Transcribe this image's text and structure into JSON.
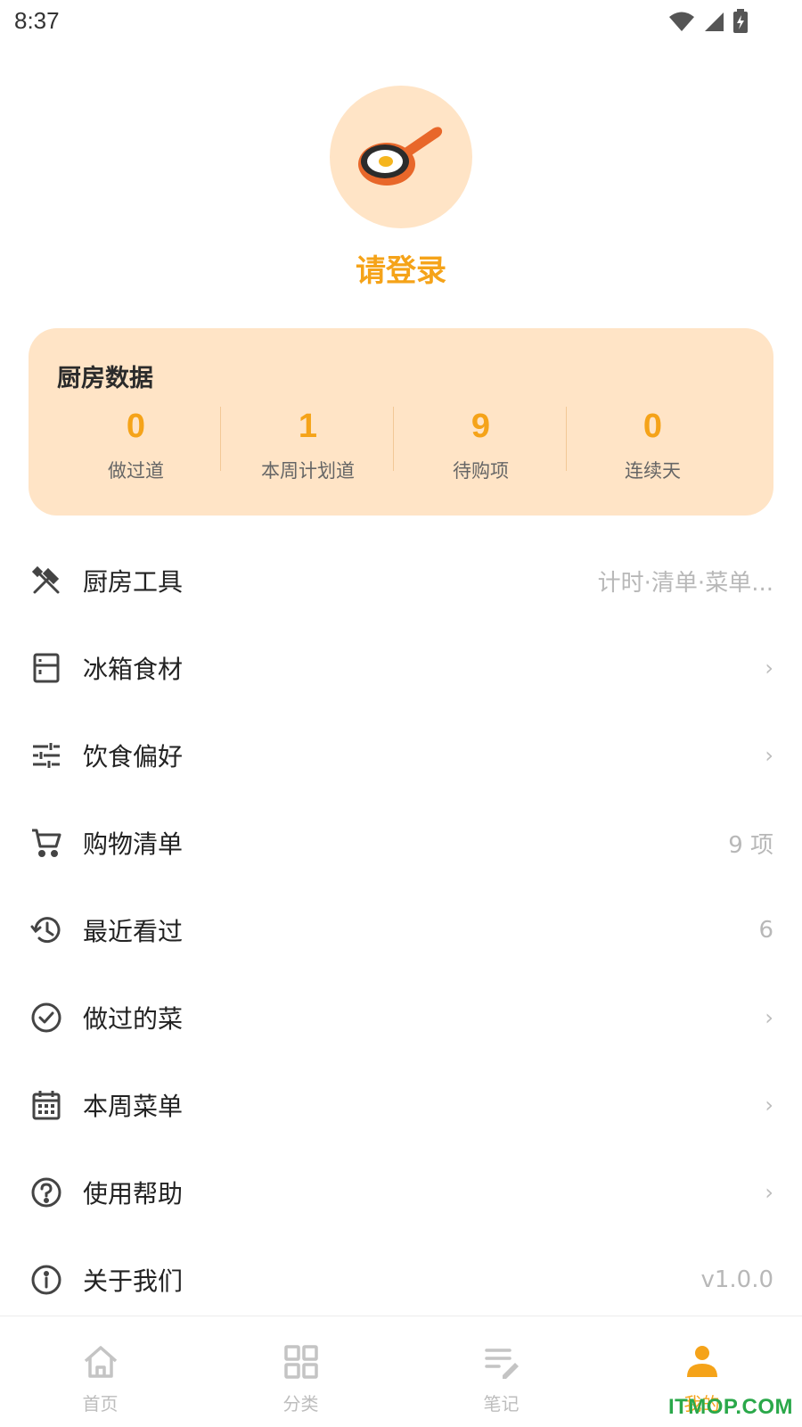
{
  "status": {
    "time": "8:37"
  },
  "profile": {
    "login_text": "请登录",
    "avatar_icon": "frying-pan-egg-icon"
  },
  "stats": {
    "title": "厨房数据",
    "items": [
      {
        "value": "0",
        "label": "做过道"
      },
      {
        "value": "1",
        "label": "本周计划道"
      },
      {
        "value": "9",
        "label": "待购项"
      },
      {
        "value": "0",
        "label": "连续天"
      }
    ]
  },
  "menu": [
    {
      "label": "厨房工具",
      "extra": "计时·清单·菜单...",
      "icon": "tools-icon"
    },
    {
      "label": "冰箱食材",
      "extra": "›",
      "icon": "fridge-icon"
    },
    {
      "label": "饮食偏好",
      "extra": "›",
      "icon": "sliders-icon"
    },
    {
      "label": "购物清单",
      "extra": "9 项",
      "icon": "cart-icon"
    },
    {
      "label": "最近看过",
      "extra": "6",
      "icon": "history-icon"
    },
    {
      "label": "做过的菜",
      "extra": "›",
      "icon": "check-circle-icon"
    },
    {
      "label": "本周菜单",
      "extra": "›",
      "icon": "calendar-icon"
    },
    {
      "label": "使用帮助",
      "extra": "›",
      "icon": "help-icon"
    },
    {
      "label": "关于我们",
      "extra": "v1.0.0",
      "icon": "info-icon"
    }
  ],
  "tabs": [
    {
      "label": "首页",
      "icon": "home-icon"
    },
    {
      "label": "分类",
      "icon": "grid-icon"
    },
    {
      "label": "笔记",
      "icon": "notes-icon"
    },
    {
      "label": "我的",
      "icon": "person-icon"
    }
  ],
  "watermark": "ITMOP.COM",
  "colors": {
    "accent": "#f5a319",
    "card_bg": "#ffe4c6",
    "muted": "#b8b8b8"
  }
}
